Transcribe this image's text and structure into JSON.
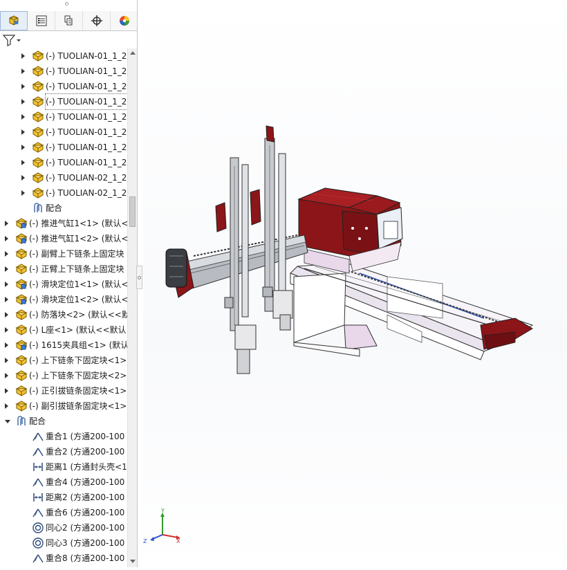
{
  "tabs": [
    {
      "icon": "feature-manager-icon",
      "active": true
    },
    {
      "icon": "property-manager-icon",
      "active": false
    },
    {
      "icon": "configuration-manager-icon",
      "active": false
    },
    {
      "icon": "dimxpert-icon",
      "active": false
    },
    {
      "icon": "display-manager-icon",
      "active": false
    }
  ],
  "filter_icon": "filter-icon",
  "tree": {
    "items": [
      {
        "label": "(-) TUOLIAN-01_1_2",
        "icon": "part-icon",
        "level": 2,
        "expander": "collapsed"
      },
      {
        "label": "(-) TUOLIAN-01_1_2",
        "icon": "part-icon",
        "level": 2,
        "expander": "collapsed"
      },
      {
        "label": "(-) TUOLIAN-01_1_2",
        "icon": "part-icon",
        "level": 2,
        "expander": "collapsed"
      },
      {
        "label": "(-) TUOLIAN-01_1_2",
        "icon": "part-icon",
        "level": 2,
        "expander": "collapsed",
        "selected": true
      },
      {
        "label": "(-) TUOLIAN-01_1_2",
        "icon": "part-icon",
        "level": 2,
        "expander": "collapsed"
      },
      {
        "label": "(-) TUOLIAN-01_1_2",
        "icon": "part-icon",
        "level": 2,
        "expander": "collapsed"
      },
      {
        "label": "(-) TUOLIAN-01_1_2",
        "icon": "part-icon",
        "level": 2,
        "expander": "collapsed"
      },
      {
        "label": "(-) TUOLIAN-01_1_2",
        "icon": "part-icon",
        "level": 2,
        "expander": "collapsed"
      },
      {
        "label": "(-) TUOLIAN-02_1_2",
        "icon": "part-icon",
        "level": 2,
        "expander": "collapsed"
      },
      {
        "label": "(-) TUOLIAN-02_1_2",
        "icon": "part-icon",
        "level": 2,
        "expander": "collapsed"
      },
      {
        "label": "配合",
        "icon": "mates-icon",
        "level": 2,
        "expander": "none"
      },
      {
        "label": "(-) 推进气缸1<1> (默认<",
        "icon": "subassembly-icon",
        "level": 1,
        "expander": "collapsed"
      },
      {
        "label": "(-) 推进气缸1<2> (默认<",
        "icon": "subassembly-icon",
        "level": 1,
        "expander": "collapsed"
      },
      {
        "label": "(-) 副臂上下链条上固定块",
        "icon": "part-icon",
        "level": 1,
        "expander": "collapsed"
      },
      {
        "label": "(-) 正臂上下链条上固定块",
        "icon": "part-icon",
        "level": 1,
        "expander": "collapsed"
      },
      {
        "label": "(-) 滑块定位1<1> (默认<",
        "icon": "subassembly-icon",
        "level": 1,
        "expander": "collapsed"
      },
      {
        "label": "(-) 滑块定位1<2> (默认<",
        "icon": "subassembly-icon",
        "level": 1,
        "expander": "collapsed"
      },
      {
        "label": "(-) 防落块<2> (默认<<默",
        "icon": "part-icon",
        "level": 1,
        "expander": "collapsed"
      },
      {
        "label": "(-) L座<1> (默认<<默认",
        "icon": "part-icon",
        "level": 1,
        "expander": "collapsed"
      },
      {
        "label": "(-) 1615夹具组<1> (默认",
        "icon": "subassembly-icon",
        "level": 1,
        "expander": "collapsed"
      },
      {
        "label": "(-) 上下链条下固定块<1>",
        "icon": "part-icon",
        "level": 1,
        "expander": "collapsed"
      },
      {
        "label": "(-) 上下链条下固定块<2>",
        "icon": "part-icon",
        "level": 1,
        "expander": "collapsed"
      },
      {
        "label": "(-) 正引拔链条固定块<1>",
        "icon": "part-icon",
        "level": 1,
        "expander": "collapsed"
      },
      {
        "label": "(-) 副引拔链条固定块<1>",
        "icon": "part-icon",
        "level": 1,
        "expander": "collapsed"
      },
      {
        "label": "配合",
        "icon": "mates-icon",
        "level": 1,
        "expander": "expanded"
      },
      {
        "label": "重合1 (方通200-100",
        "icon": "coincident-mate-icon",
        "level": 2,
        "expander": "none"
      },
      {
        "label": "重合2 (方通200-100",
        "icon": "coincident-mate-icon",
        "level": 2,
        "expander": "none"
      },
      {
        "label": "距离1 (方通封头壳<1",
        "icon": "distance-mate-icon",
        "level": 2,
        "expander": "none"
      },
      {
        "label": "重合4 (方通200-100",
        "icon": "coincident-mate-icon",
        "level": 2,
        "expander": "none"
      },
      {
        "label": "距离2 (方通200-100",
        "icon": "distance-mate-icon",
        "level": 2,
        "expander": "none"
      },
      {
        "label": "重合6 (方通200-100",
        "icon": "coincident-mate-icon",
        "level": 2,
        "expander": "none"
      },
      {
        "label": "同心2 (方通200-100",
        "icon": "concentric-mate-icon",
        "level": 2,
        "expander": "none"
      },
      {
        "label": "同心3 (方通200-100",
        "icon": "concentric-mate-icon",
        "level": 2,
        "expander": "none"
      },
      {
        "label": "重合8 (方通200-100",
        "icon": "coincident-mate-icon",
        "level": 2,
        "expander": "none"
      }
    ]
  },
  "triad": {
    "x": "X",
    "y": "Y",
    "z": "Z"
  },
  "colors": {
    "housing_red": "#8b1518",
    "base_white": "#f4f2f6",
    "rail_gray": "#9aa0a6",
    "accent_blue": "#2a4fb0",
    "highlight_pink": "#e8d8ea"
  }
}
